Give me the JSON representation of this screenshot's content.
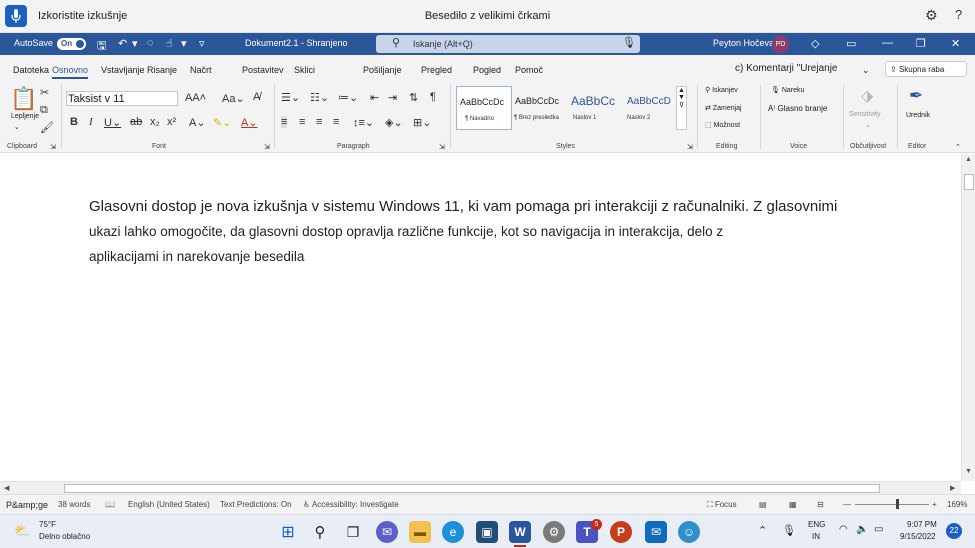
{
  "voice_bar": {
    "status": "Izkoristite izkušnje",
    "command": "Besedilo z velikimi črkami"
  },
  "titlebar": {
    "autosave_label": "AutoSave",
    "autosave_state": "On",
    "doc_title": "Dokument2.1 - Shranjeno",
    "search_placeholder": "Iskanje (Alt+Q)",
    "user_name": "Peyton Hočevar",
    "user_initials": "PD"
  },
  "tabs": [
    "Datoteka",
    "Osnovno",
    "Vstavljanje",
    "Risanje",
    "Načrt",
    "Postavitev",
    "Sklici",
    "Pošiljanje",
    "Pregled",
    "Pogled",
    "Pomoč"
  ],
  "tabs_right": {
    "comments": "c) Komentarji \"Urejanje",
    "share": "Skupna raba"
  },
  "ribbon": {
    "clipboard": {
      "paste": "Lepljenje",
      "label": "Clipboard"
    },
    "font": {
      "name": "Taksist v 11",
      "label": "Font"
    },
    "paragraph": {
      "label": "Paragraph"
    },
    "styles": {
      "items": [
        {
          "sample": "AaBbCcDc",
          "name": "¶ Navadno"
        },
        {
          "sample": "AaBbCcDc",
          "name": "¶ Brez presledka"
        },
        {
          "sample": "AaBbCc",
          "name": "Naslov 1"
        },
        {
          "sample": "AaBbCcD",
          "name": "Naslov 2"
        }
      ],
      "label": "Styles"
    },
    "editing": {
      "find": "Iskanjev",
      "replace": "Zamenjaj",
      "select": "Možnost",
      "label": "Editing"
    },
    "voice": {
      "dictate": "Nareku",
      "read_aloud": "Glasno branje",
      "label": "Voice"
    },
    "sensitivity": {
      "name": "Sensitivity",
      "label": "Občutljivost"
    },
    "editor": {
      "name": "Urednik",
      "label": "Editor"
    }
  },
  "document": {
    "lines": [
      "Glasovni dostop je nova izkušnja v sistemu Windows 11, ki vam pomaga pri interakciji z računalniki. Z glasovnimi",
      "ukazi lahko omogočite, da glasovni dostop opravlja različne funkcije, kot so navigacija in interakcija, delo z",
      "aplikacijami in narekovanje besedila"
    ]
  },
  "statusbar": {
    "page": "P&amp;ge",
    "words": "38 words",
    "language": "English (United States)",
    "predictions": "Text Predictions: On",
    "accessibility": "Accessibility: Investigate",
    "focus": "Focus",
    "zoom": "169%"
  },
  "taskbar": {
    "weather_temp": "75°F",
    "weather_desc": "Delno oblačno",
    "lang_top": "ENG",
    "lang_bottom": "IN",
    "time": "9:07 PM",
    "date": "9/15/2022",
    "teams_badge": "5",
    "notifications": "22"
  },
  "colors": {
    "word_blue": "#2b579a",
    "voice_blue": "#1b5fc2"
  }
}
